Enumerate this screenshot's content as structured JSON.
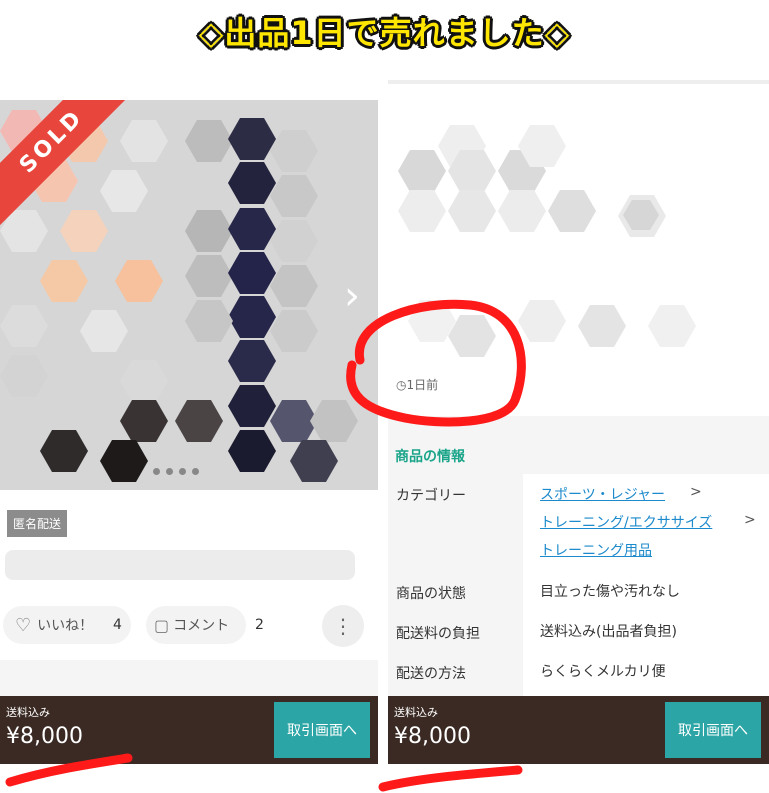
{
  "headline": "◇出品1日で売れました◇",
  "left": {
    "sold_label": "SOLD",
    "anonymous_badge": "匿名配送",
    "like_label": "いいね！",
    "like_count": "4",
    "comment_label": "コメント",
    "comment_count": "2",
    "bottom": {
      "shipping_label": "送料込み",
      "price": "¥8,000",
      "trade_button": "取引画面へ"
    }
  },
  "right": {
    "posted_time": "1日前",
    "info_title": "商品の情報",
    "category_label": "カテゴリー",
    "category_path": [
      "スポーツ・レジャー",
      "トレーニング/エクササイズ",
      "トレーニング用品"
    ],
    "condition_label": "商品の状態",
    "condition_value": "目立った傷や汚れなし",
    "shipping_fee_label": "配送料の負担",
    "shipping_fee_value": "送料込み(出品者負担)",
    "shipping_method_label": "配送の方法",
    "shipping_method_value": "らくらくメルカリ便",
    "bottom": {
      "shipping_label": "送料込み",
      "price": "¥8,000",
      "trade_button": "取引画面へ"
    }
  },
  "colors": {
    "accent_teal": "#2ba5a5",
    "heading_green": "#1aa58a",
    "bottom_bar": "#3a2a23",
    "sold_red": "#e8463d",
    "marker_red": "#ff1a1a",
    "headline_yellow": "#ffe600"
  }
}
